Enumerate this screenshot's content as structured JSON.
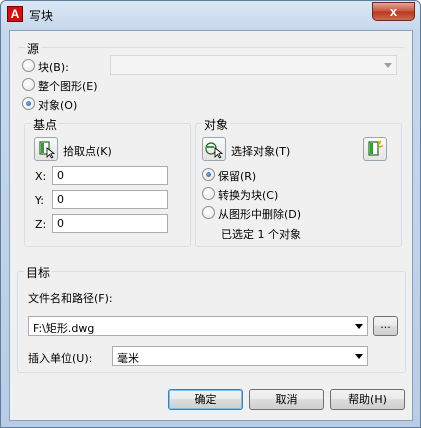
{
  "window": {
    "title": "写块",
    "app_icon_letter": "A",
    "close_glyph": "x"
  },
  "source": {
    "title": "源",
    "options": [
      {
        "label": "块(B):",
        "selected": false
      },
      {
        "label": "整个图形(E)",
        "selected": false
      },
      {
        "label": "对象(O)",
        "selected": true
      }
    ],
    "block_combo_value": ""
  },
  "base_point": {
    "title": "基点",
    "pick_label": "拾取点(K)",
    "x_label": "X:",
    "x_value": "0",
    "y_label": "Y:",
    "y_value": "0",
    "z_label": "Z:",
    "z_value": "0"
  },
  "objects": {
    "title": "对象",
    "select_label": "选择对象(T)",
    "options": [
      {
        "label": "保留(R)",
        "selected": true
      },
      {
        "label": "转换为块(C)",
        "selected": false
      },
      {
        "label": "从图形中删除(D)",
        "selected": false
      }
    ],
    "status": "已选定 1 个对象"
  },
  "destination": {
    "title": "目标",
    "path_label": "文件名和路径(F):",
    "path_value": "F:\\矩形.dwg",
    "browse_label": "...",
    "units_label": "插入单位(U):",
    "units_value": "毫米"
  },
  "buttons": {
    "ok": "确定",
    "cancel": "取消",
    "help": "帮助(H)"
  },
  "colors": {
    "accent": "#3c7fb1",
    "close": "#c8523a"
  }
}
